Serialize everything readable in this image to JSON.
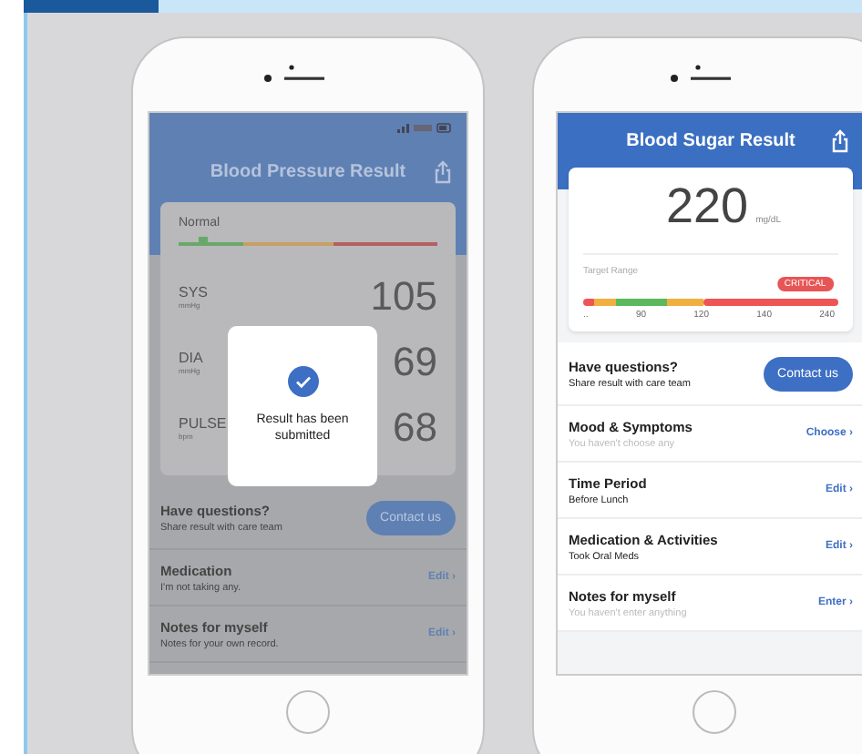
{
  "phones": [
    {
      "kind": "blood_pressure",
      "dimmed": true,
      "title": "Blood Pressure Result",
      "category": "Normal",
      "level": 0.09,
      "readings": [
        {
          "label": "SYS",
          "unit": "mmHg",
          "value": "105"
        },
        {
          "label": "DIA",
          "unit": "mmHg",
          "value": "69"
        },
        {
          "label": "PULSE",
          "unit": "bpm",
          "value": "68"
        }
      ],
      "dialog": {
        "message": "Result has been submitted"
      },
      "contact": {
        "title": "Have questions?",
        "subtitle": "Share result with care team",
        "button": "Contact us"
      },
      "rows": [
        {
          "title": "Medication",
          "subtitle": "I'm not taking any.",
          "empty": false,
          "action": "Edit ›"
        },
        {
          "title": "Notes for myself",
          "subtitle": "Notes for your own record.",
          "empty": false,
          "action": "Edit ›"
        }
      ]
    },
    {
      "kind": "blood_sugar",
      "dimmed": false,
      "title": "Blood Sugar Result",
      "value": "220",
      "unit": "mg/dL",
      "range_label": "Target Range",
      "badge": "CRITICAL",
      "level": 0.87,
      "ticks": [
        "..",
        "90",
        "120",
        "140",
        "240"
      ],
      "contact": {
        "title": "Have questions?",
        "subtitle": "Share result with care team",
        "button": "Contact us"
      },
      "rows": [
        {
          "title": "Mood & Symptoms",
          "subtitle": "You haven't choose any",
          "empty": true,
          "action": "Choose ›"
        },
        {
          "title": "Time Period",
          "subtitle": "Before Lunch",
          "empty": false,
          "action": "Edit ›"
        },
        {
          "title": "Medication & Activities",
          "subtitle": "Took Oral Meds",
          "empty": false,
          "action": "Edit ›"
        },
        {
          "title": "Notes for myself",
          "subtitle": "You haven't enter anything",
          "empty": true,
          "action": "Enter ›"
        }
      ]
    }
  ]
}
